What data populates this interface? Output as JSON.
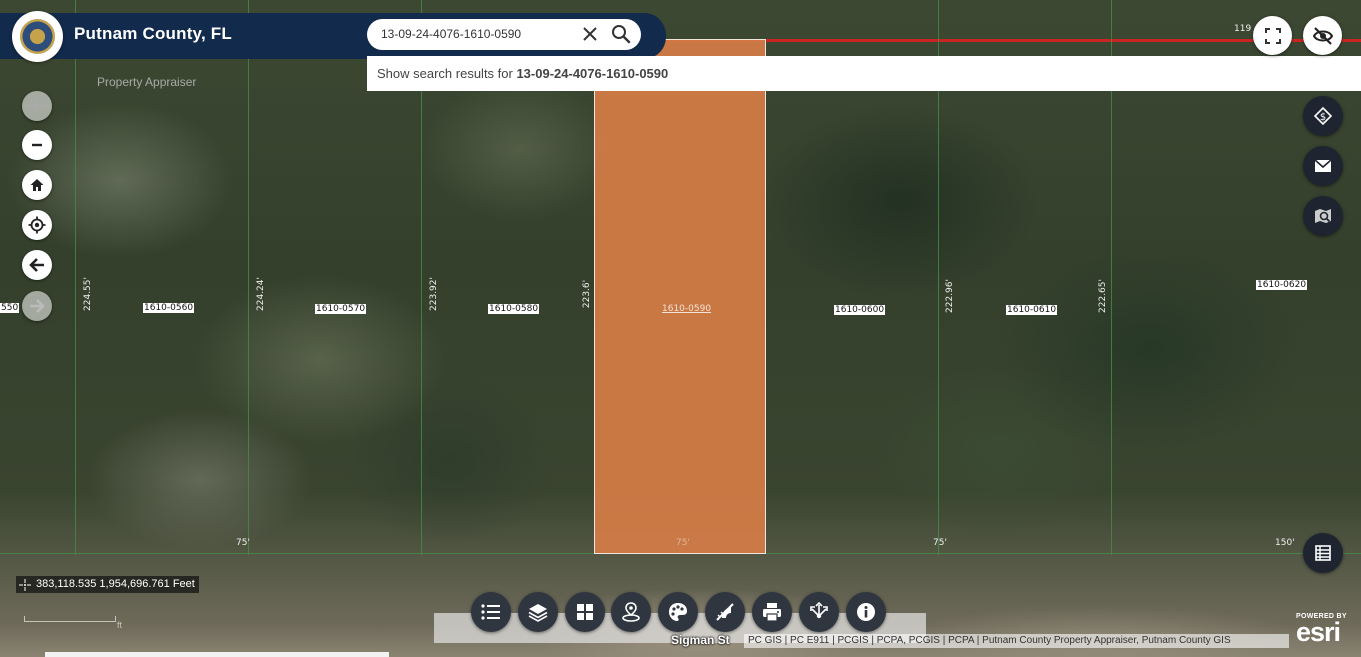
{
  "header": {
    "title": "Putnam County, FL",
    "subtitle": "Property Appraiser"
  },
  "search": {
    "value": "13-09-24-4076-1610-0590",
    "suggestion_prefix": "Show search results for ",
    "suggestion_term": "13-09-24-4076-1610-0590"
  },
  "map": {
    "parcels": [
      {
        "label": "550"
      },
      {
        "label": "1610-0560"
      },
      {
        "label": "1610-0570"
      },
      {
        "label": "1610-0580"
      },
      {
        "label": "1610-0590",
        "selected": true
      },
      {
        "label": "1610-0600"
      },
      {
        "label": "1610-0610"
      },
      {
        "label": "1610-0620"
      }
    ],
    "dimensions": {
      "d1": "224.55'",
      "d2": "224.24'",
      "d3": "223.92'",
      "d4": "223.6'",
      "d5": "222.96'",
      "d6": "222.65'",
      "b1": "75'",
      "b2": "75'",
      "b3": "75'",
      "b4": "150'",
      "top_right": "119"
    },
    "street": "Sigman St",
    "highlight_color": "#d67d46",
    "road_color": "#d82020"
  },
  "coords": {
    "text": "383,118.535 1,954,696.761 Feet"
  },
  "scale": {
    "label": "ft"
  },
  "attribution": "PC GIS | PC E911 | PCGIS | PCPA, PCGIS | PCPA | Putnam County Property Appraiser, Putnam County GIS",
  "esri": {
    "powered_by": "POWERED BY",
    "name": "esri"
  },
  "colors": {
    "header_bg": "#122a4b",
    "dark_button": "#1e2530"
  }
}
